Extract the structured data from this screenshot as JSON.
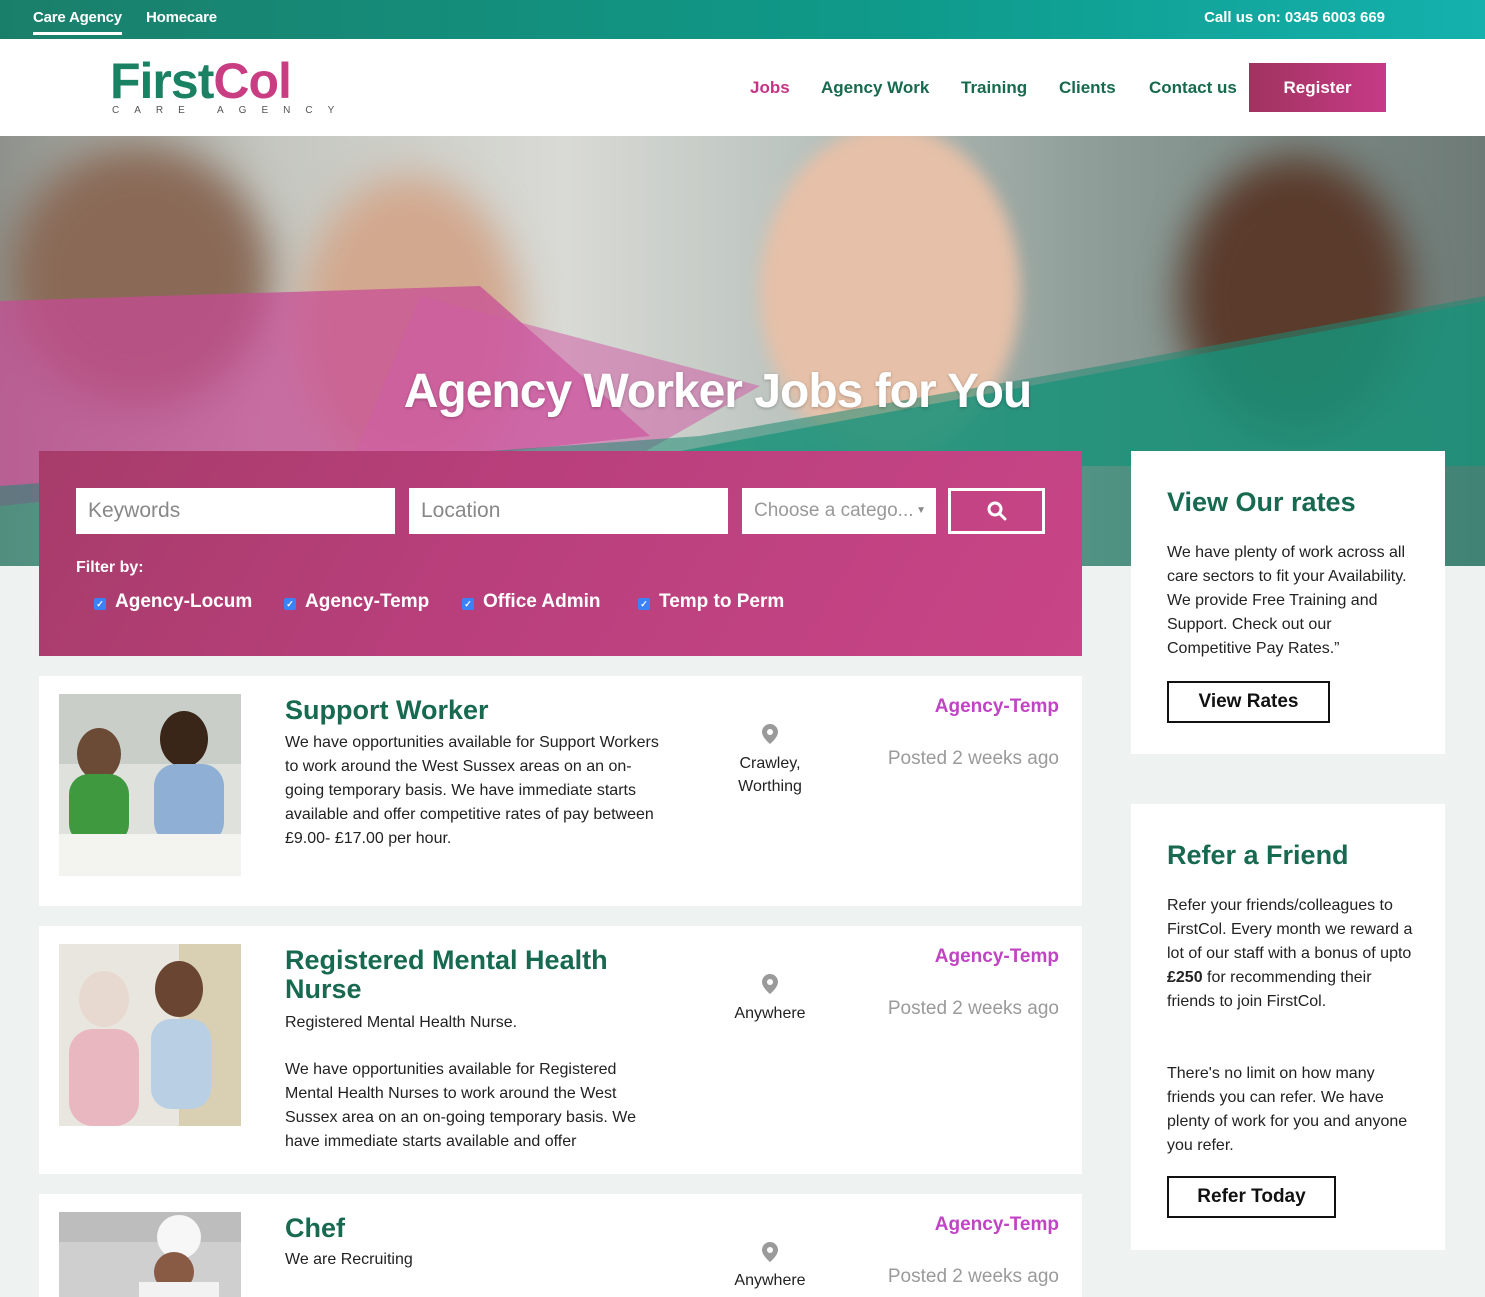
{
  "topbar": {
    "link1": "Care Agency",
    "link2": "Homecare",
    "phone": "Call us on: 0345 6003 669"
  },
  "brand": {
    "name_part1": "First",
    "name_part2": "Col",
    "tagline": "CARE AGENCY"
  },
  "nav": {
    "jobs": "Jobs",
    "agency_work": "Agency Work",
    "training": "Training",
    "clients": "Clients",
    "contact": "Contact us",
    "register": "Register"
  },
  "hero": {
    "title": "Agency Worker Jobs for You"
  },
  "search": {
    "keywords_placeholder": "Keywords",
    "location_placeholder": "Location",
    "category_selected": "Choose a catego...",
    "filter_label": "Filter by:",
    "filters": [
      "Agency-Locum",
      "Agency-Temp",
      "Office Admin",
      "Temp to Perm"
    ]
  },
  "jobs": [
    {
      "title": "Support Worker",
      "description": "We have opportunities available for Support Workers to work around the West Sussex areas on an on-going temporary basis. We have immediate starts available and offer competitive rates of pay between £9.00- £17.00 per hour.",
      "location": "Crawley, Worthing",
      "type": "Agency-Temp",
      "posted": "Posted 2 weeks ago"
    },
    {
      "title": "Registered Mental Health Nurse",
      "summary": "Registered Mental Health Nurse.",
      "description": "We have opportunities available for Registered Mental Health Nurses to work around the West Sussex area on an on-going temporary basis. We have immediate starts available and offer",
      "location": "Anywhere",
      "type": "Agency-Temp",
      "posted": "Posted 2 weeks ago"
    },
    {
      "title": "Chef",
      "description": "We are Recruiting",
      "location": "Anywhere",
      "type": "Agency-Temp",
      "posted": "Posted 2 weeks ago"
    }
  ],
  "sidebar": {
    "rates": {
      "title": "View Our rates",
      "text": "We have plenty of work across all care sectors to fit your Availability. We provide Free Training and Support. Check out our Competitive Pay Rates.”",
      "button": "View Rates"
    },
    "refer": {
      "title": "Refer a Friend",
      "text1_a": "Refer your friends/colleagues to FirstCol. Every month we reward a lot of our staff with a bonus of upto ",
      "text1_bold": "£250",
      "text1_b": " for recommending their friends to join FirstCol.",
      "text2": "There's no limit on how many friends you can refer. We have plenty of work for you and anyone you refer.",
      "button": "Refer Today"
    }
  },
  "colors": {
    "brand_green": "#17694f",
    "brand_pink": "#c63584",
    "accent_teal": "#0f9a8a",
    "tag_purple": "#c044c4"
  },
  "icons": {
    "search": "search-icon",
    "location": "map-pin-icon",
    "checkbox": "checkbox-checked-icon"
  }
}
